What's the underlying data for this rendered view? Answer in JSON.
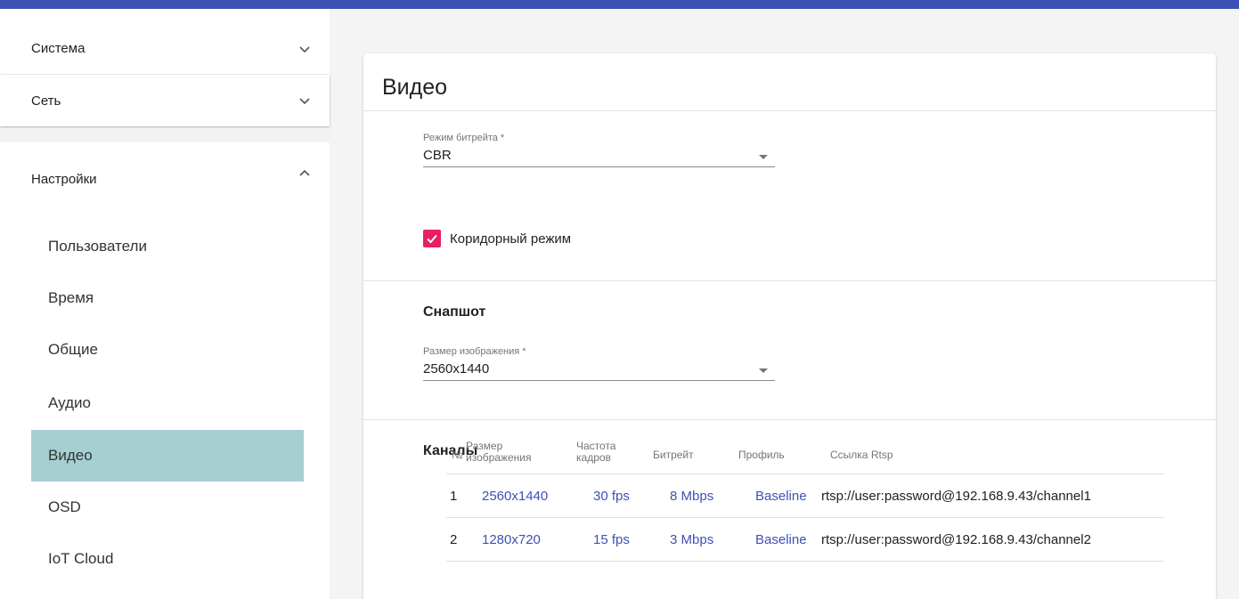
{
  "sidebar": {
    "groups": [
      {
        "label": "Система",
        "icon": "chevron-down-icon"
      },
      {
        "label": "Сеть",
        "icon": "chevron-down-icon"
      },
      {
        "label": "Настройки",
        "icon": "chevron-up-icon"
      }
    ],
    "items": [
      {
        "label": "Пользователи",
        "active": false
      },
      {
        "label": "Время",
        "active": false
      },
      {
        "label": "Общие",
        "active": false
      },
      {
        "label": "Аудио",
        "active": false
      },
      {
        "label": "Видео",
        "active": true
      },
      {
        "label": "OSD",
        "active": false
      },
      {
        "label": "IoT Cloud",
        "active": false
      }
    ]
  },
  "main": {
    "title": "Видео",
    "bitrate_mode": {
      "label": "Режим битрейта *",
      "value": "CBR"
    },
    "corridor_mode": {
      "label": "Коридорный режим",
      "checked": true
    },
    "snapshot": {
      "title": "Снапшот",
      "image_size": {
        "label": "Размер изображения *",
        "value": "2560x1440"
      }
    },
    "channels": {
      "title": "Каналы",
      "columns": {
        "num": "№",
        "size": [
          "Размер",
          "изображения"
        ],
        "fps": [
          "Частота",
          "кадров"
        ],
        "bitrate": "Битрейт",
        "profile": "Профиль",
        "rtsp": "Ссылка Rtsp"
      },
      "rows": [
        {
          "num": "1",
          "size": "2560x1440",
          "fps": "30 fps",
          "bitrate": "8 Mbps",
          "profile": "Baseline",
          "rtsp": "rtsp://user:password@192.168.9.43/channel1"
        },
        {
          "num": "2",
          "size": "1280x720",
          "fps": "15 fps",
          "bitrate": "3 Mbps",
          "profile": "Baseline",
          "rtsp": "rtsp://user:password@192.168.9.43/channel2"
        }
      ]
    }
  },
  "colors": {
    "accent": "#3f51b5",
    "active_item": "#a5cfd0",
    "checkbox": "#e91e63"
  }
}
